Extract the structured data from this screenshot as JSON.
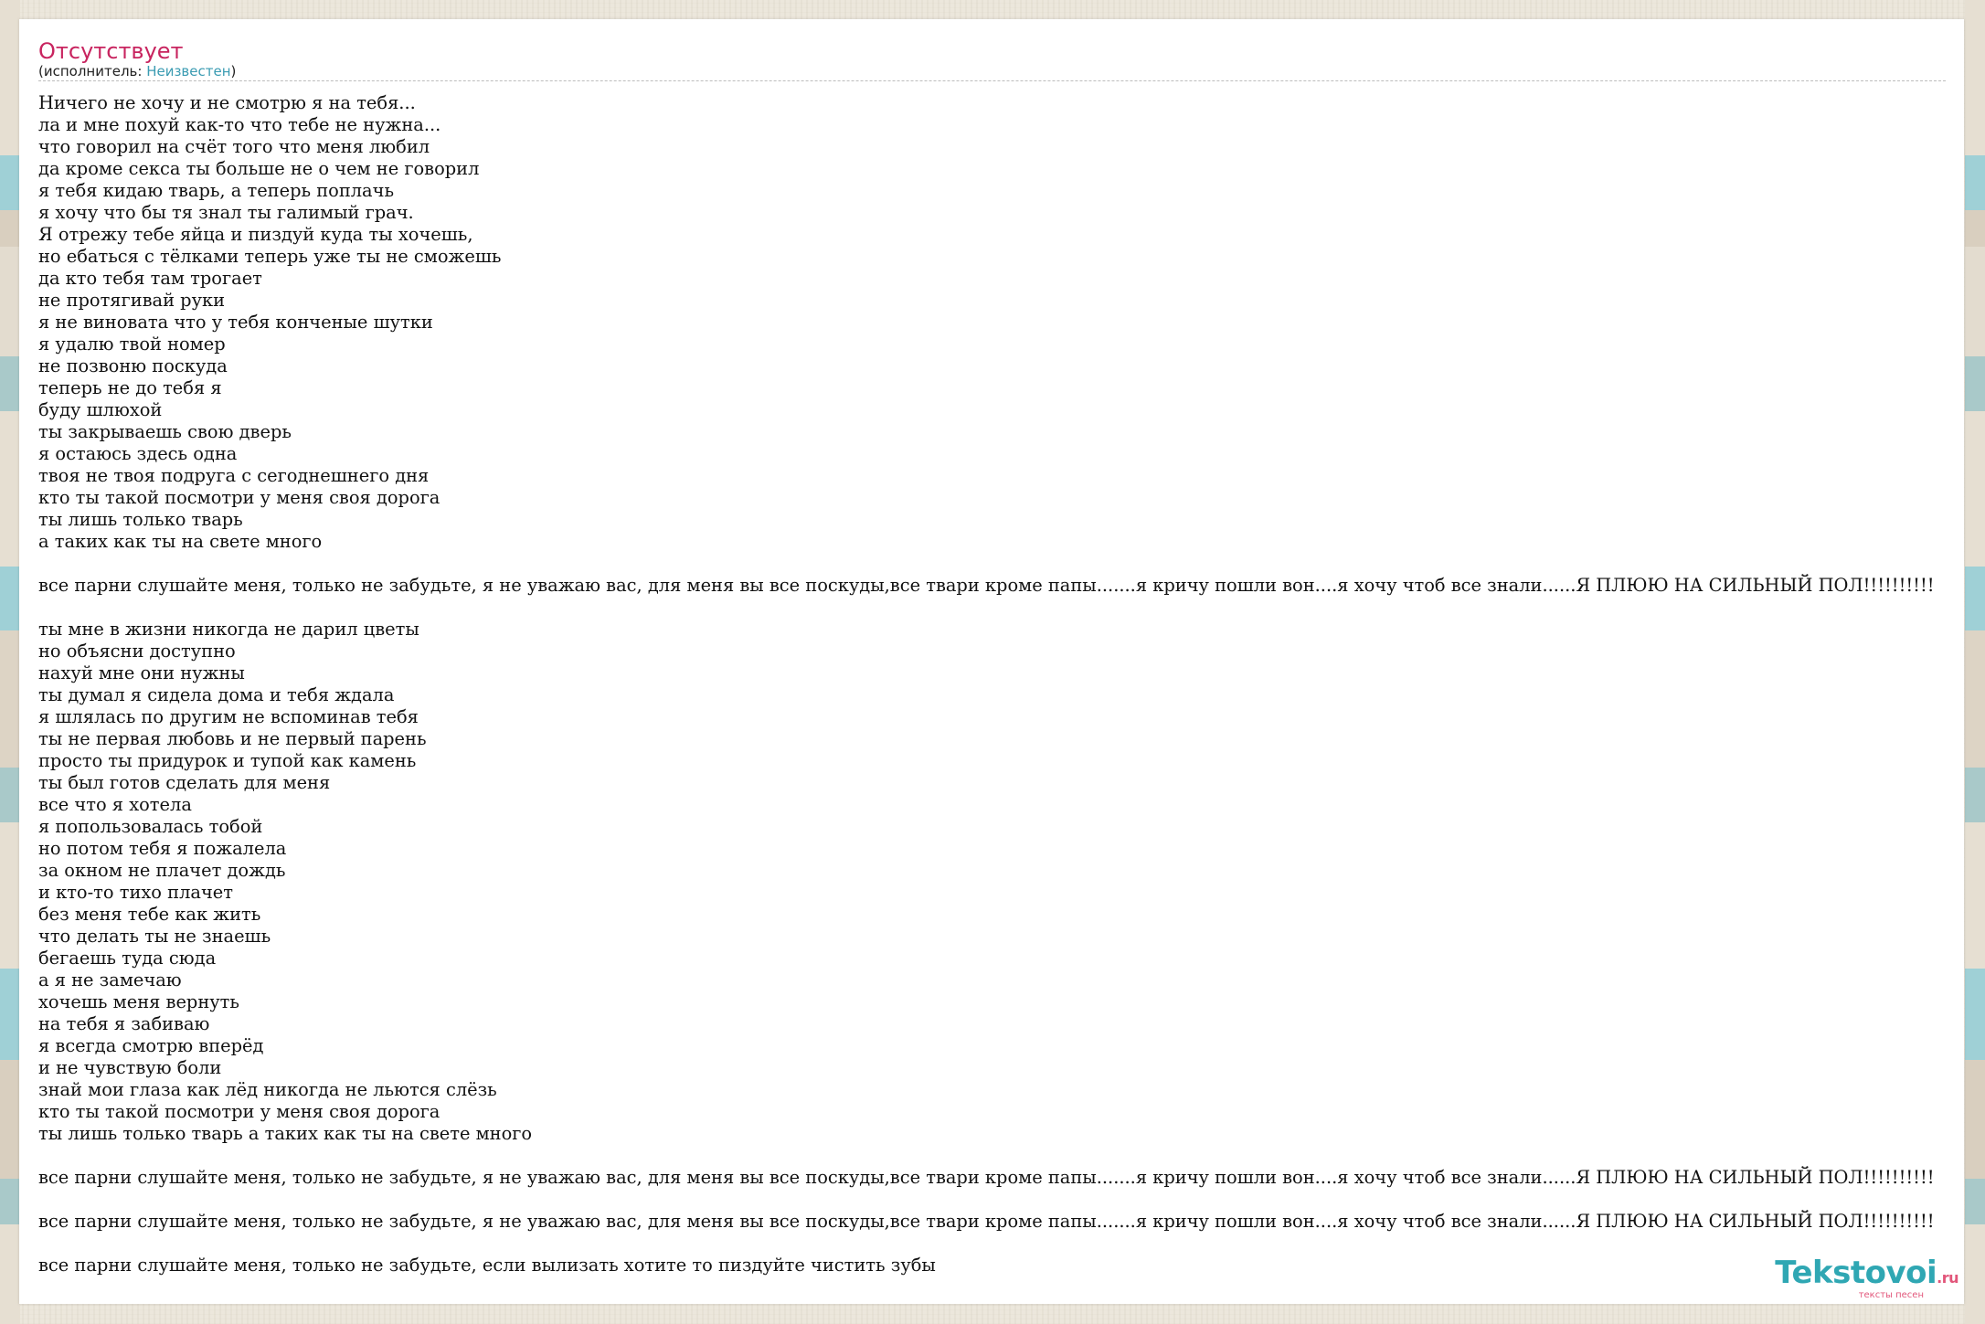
{
  "song": {
    "title": "Отсутствует",
    "performer_prefix": "(исполнитель: ",
    "performer_name": "Неизвестен",
    "performer_suffix": ")"
  },
  "lyrics": [
    "Ничего не хочу и не смотрю я на тебя...",
    "ла и мне похуй как-то что тебе не нужна...",
    "что говорил на счёт того что меня любил",
    "да кроме секса ты больше не о чем не говорил",
    "я тебя кидаю тварь, а теперь поплачь",
    "я хочу что бы тя знал ты галимый грач.",
    "Я отрежу тебе яйца и пиздуй куда ты хочешь,",
    "но ебаться с тёлками теперь уже ты не сможешь",
    "да кто тебя там трогает",
    "не протягивай руки",
    "я не виновата что у тебя конченые шутки",
    "я удалю твой номер",
    "не позвоню поскуда",
    "теперь не до тебя я",
    "буду шлюхой",
    "ты закрываешь свою дверь",
    "я остаюсь здесь одна",
    "твоя не твоя подруга с сегоднешнего дня",
    "кто ты такой посмотри у меня своя дорога",
    "ты лишь только тварь",
    "а таких как ты на свете много",
    "",
    "все парни слушайте меня, только не забудьте, я не уважаю вас, для меня вы все поскуды,все твари кроме папы.......я кричу пошли вон....я хочу чтоб все знали......Я ПЛЮЮ НА СИЛЬНЫЙ ПОЛ!!!!!!!!!!",
    "",
    "ты мне в жизни никогда не дарил цветы",
    "но объясни доступно",
    "нахуй мне они нужны",
    "ты думал я сидела дома и тебя ждала",
    "я шлялась по другим не вспоминав тебя",
    "ты не первая любовь и не первый парень",
    "просто ты придурок и тупой как камень",
    "ты был готов сделать для меня",
    "все что я хотела",
    "я попользовалась тобой",
    "но потом тебя я пожалела",
    "за окном не плачет дождь",
    "и кто-то тихо плачет",
    "без меня тебе как жить",
    "что делать ты не знаешь",
    "бегаешь туда сюда",
    "а я не замечаю",
    "хочешь меня вернуть",
    "на тебя я забиваю",
    "я всегда смотрю вперёд",
    "и не чувствую боли",
    "знай мои глаза как лёд никогда не льются слёзь",
    "кто ты такой посмотри у меня своя дорога",
    "ты лишь только тварь а таких как ты на свете много",
    "",
    "все парни слушайте меня, только не забудьте, я не уважаю вас, для меня вы все поскуды,все твари кроме папы.......я кричу пошли вон....я хочу чтоб все знали......Я ПЛЮЮ НА СИЛЬНЫЙ ПОЛ!!!!!!!!!!",
    "",
    "все парни слушайте меня, только не забудьте, я не уважаю вас, для меня вы все поскуды,все твари кроме папы.......я кричу пошли вон....я хочу чтоб все знали......Я ПЛЮЮ НА СИЛЬНЫЙ ПОЛ!!!!!!!!!!",
    "",
    "все парни слушайте меня, только не забудьте, если вылизать хотите то пиздуйте чистить зубы"
  ],
  "logo": {
    "name": "Tekstovoi",
    "suffix": ".ru",
    "tagline": "тексты песен"
  },
  "colors": {
    "title": "#c8245f",
    "link": "#3a9bb2",
    "logo": "#2fa7b3",
    "logo_accent": "#e2567a"
  }
}
